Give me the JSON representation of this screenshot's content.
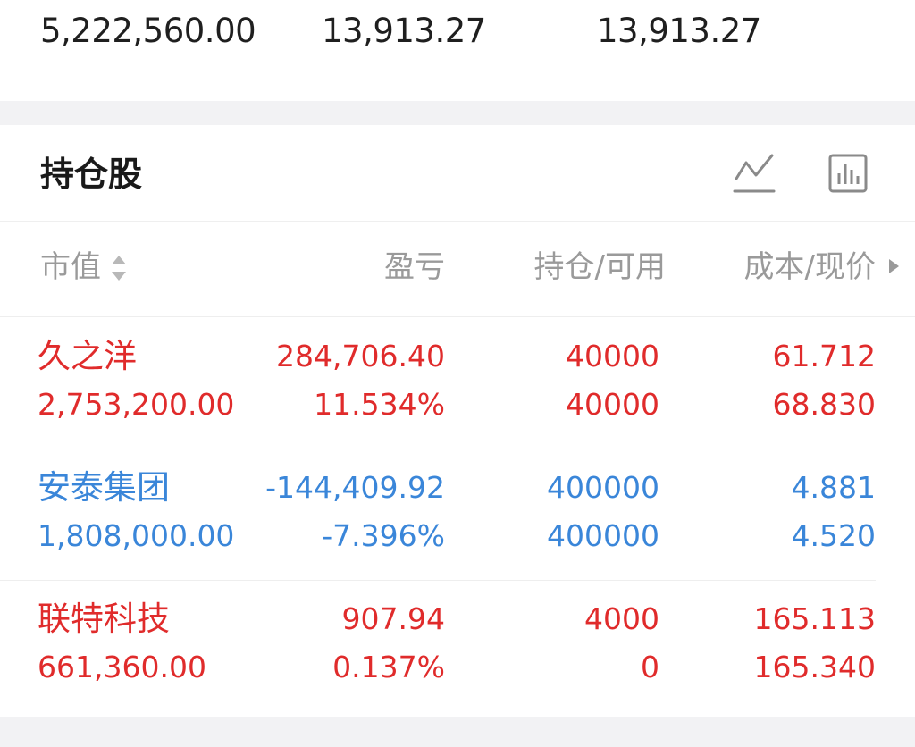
{
  "summary": {
    "values": [
      "5,222,560.00",
      "13,913.27",
      "13,913.27"
    ]
  },
  "holdings": {
    "title": "持仓股",
    "icons": {
      "line_chart": "line-chart-icon",
      "bar_chart": "bar-chart-icon"
    },
    "columns": {
      "market_value": "市值",
      "profit_loss": "盈亏",
      "position_available": "持仓/可用",
      "cost_price": "成本/现价"
    },
    "colors": {
      "up": "#e02b2b",
      "down": "#3a86d9"
    },
    "rows": [
      {
        "name": "久之洋",
        "market_value": "2,753,200.00",
        "pnl": "284,706.40",
        "pnl_pct": "11.534%",
        "position": "40000",
        "available": "40000",
        "cost": "61.712",
        "price": "68.830",
        "trend": "up"
      },
      {
        "name": "安泰集团",
        "market_value": "1,808,000.00",
        "pnl": "-144,409.92",
        "pnl_pct": "-7.396%",
        "position": "400000",
        "available": "400000",
        "cost": "4.881",
        "price": "4.520",
        "trend": "down"
      },
      {
        "name": "联特科技",
        "market_value": "661,360.00",
        "pnl": "907.94",
        "pnl_pct": "0.137%",
        "position": "4000",
        "available": "0",
        "cost": "165.113",
        "price": "165.340",
        "trend": "up"
      }
    ]
  }
}
